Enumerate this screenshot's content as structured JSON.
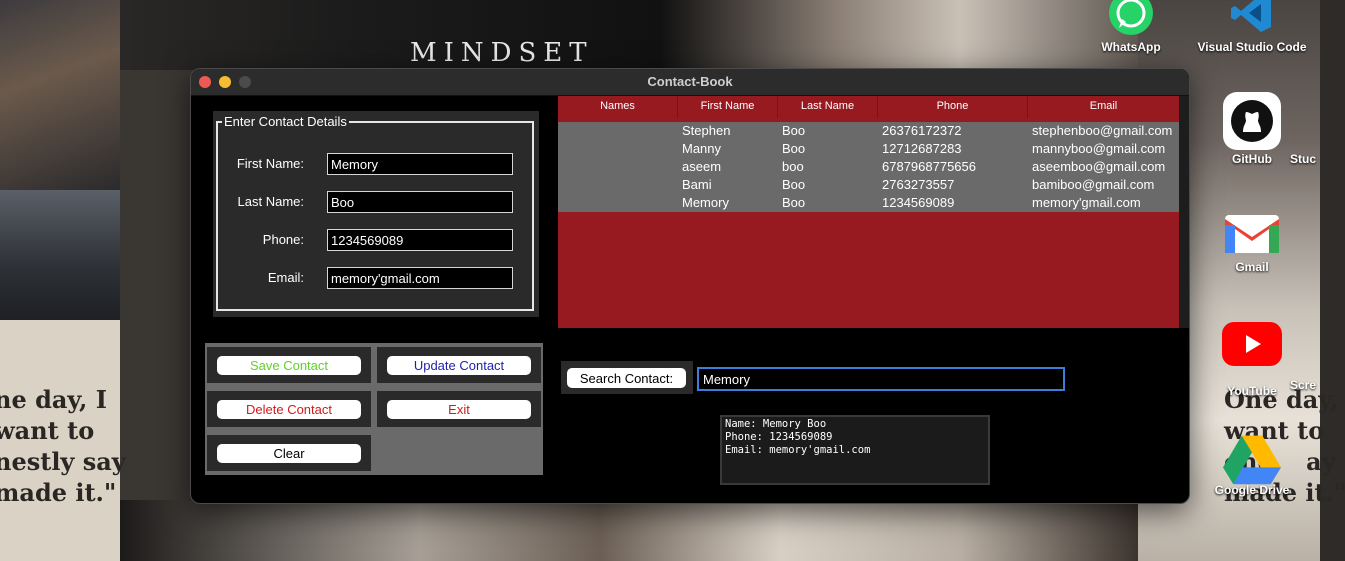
{
  "desktop": {
    "wallpaper_heading": "MINDSET",
    "quote_left": "ne day, I\nwant to\nnestly say\nmade it.\"",
    "quote_right": "One day, I\nwant to\none    ay\nmade it.\"",
    "icons": [
      {
        "label": "WhatsApp",
        "icon": "whatsapp-icon",
        "color": "#25d366"
      },
      {
        "label": "Visual Studio Code",
        "icon": "vscode-icon",
        "color": "#1f8ad2"
      },
      {
        "label": "GitHub",
        "icon": "github-icon",
        "color": "#ffffff"
      },
      {
        "label": "Gmail",
        "icon": "gmail-icon",
        "color": "#ea4335"
      },
      {
        "label": "YouTube",
        "icon": "youtube-icon",
        "color": "#ff0000"
      },
      {
        "label": "Google Drive",
        "icon": "google-drive-icon",
        "color": "#1fa463"
      },
      {
        "label": "Stuc",
        "icon": "folder-icon"
      },
      {
        "label": "Scre",
        "icon": "screenshot-icon"
      }
    ]
  },
  "window": {
    "title": "Contact-Book",
    "form": {
      "legend": "Enter Contact Details",
      "fields": [
        {
          "label": "First Name:",
          "value": "Memory"
        },
        {
          "label": "Last Name:",
          "value": "Boo"
        },
        {
          "label": "Phone:",
          "value": "1234569089"
        },
        {
          "label": "Email:",
          "value": "memory'gmail.com"
        }
      ]
    },
    "buttons": {
      "save": {
        "label": "Save Contact",
        "color": "#5fd12a"
      },
      "update": {
        "label": "Update Contact",
        "color": "#1f1fae"
      },
      "delete": {
        "label": "Delete Contact",
        "color": "#d11a1a"
      },
      "exit": {
        "label": "Exit",
        "color": "#d11a1a"
      },
      "clear": {
        "label": "Clear",
        "color": "#000000"
      }
    },
    "table": {
      "header_color": "#971a21",
      "columns": [
        "Names",
        "First Name",
        "Last Name",
        "Phone",
        "Email"
      ],
      "rows": [
        [
          "",
          "Stephen",
          "Boo",
          "26376172372",
          "stephenboo@gmail.com"
        ],
        [
          "",
          "Manny",
          "Boo",
          "12712687283",
          "mannyboo@gmail.com"
        ],
        [
          "",
          "aseem",
          "boo",
          "6787968775656",
          "aseemboo@gmail.com"
        ],
        [
          "",
          "Bami",
          "Boo",
          "2763273557",
          "bamiboo@gmail.com"
        ],
        [
          "",
          "Memory",
          "Boo",
          "1234569089",
          "memory'gmail.com"
        ]
      ]
    },
    "search": {
      "button_label": "Search Contact:",
      "value": "Memory",
      "result": "Name: Memory Boo\nPhone: 1234569089\nEmail: memory'gmail.com"
    }
  }
}
